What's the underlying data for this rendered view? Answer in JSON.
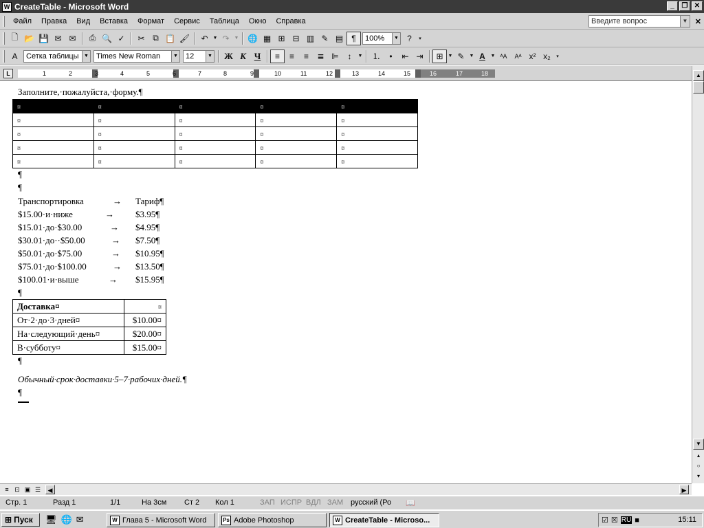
{
  "window": {
    "title": "CreateTable - Microsoft Word"
  },
  "menu": {
    "items": [
      "Файл",
      "Правка",
      "Вид",
      "Вставка",
      "Формат",
      "Сервис",
      "Таблица",
      "Окно",
      "Справка"
    ],
    "ask_placeholder": "Введите вопрос"
  },
  "toolbar_standard": {
    "zoom": "100%"
  },
  "toolbar_format": {
    "style": "Сетка таблицы",
    "font": "Times New Roman",
    "size": "12"
  },
  "ruler": {
    "numbers": [
      "1",
      "2",
      "3",
      "4",
      "5",
      "6",
      "7",
      "8",
      "9",
      "10",
      "11",
      "12",
      "13",
      "14",
      "15",
      "16",
      "17",
      "18"
    ]
  },
  "document": {
    "intro": "Заполните,·пожалуйста,·форму.¶",
    "form_table": {
      "rows": 5,
      "cols": 5,
      "cell_mark": "¤"
    },
    "empty_para": "¶",
    "tariff": {
      "header": [
        "Транспортировка",
        "Тариф¶"
      ],
      "rows": [
        [
          "$15.00·и·ниже",
          "$3.95¶"
        ],
        [
          "$15.01·до·$30.00",
          "$4.95¶"
        ],
        [
          "$30.01·до··$50.00",
          "$7.50¶"
        ],
        [
          "$50.01·до·$75.00",
          "$10.95¶"
        ],
        [
          "$75.01·до·$100.00",
          "$13.50¶"
        ],
        [
          "$100.01·и·выше",
          "$15.95¶"
        ]
      ],
      "arrow": "→"
    },
    "delivery_table": {
      "header": "Доставка¤",
      "rows": [
        [
          "От·2·до·3·дней¤",
          "$10.00¤"
        ],
        [
          "На·следующий·день¤",
          "$20.00¤"
        ],
        [
          "В·субботу¤",
          "$15.00¤"
        ]
      ]
    },
    "note": "Обычный·срок·доставки·5–7·рабочих·дней.¶"
  },
  "status": {
    "page": "Стр. 1",
    "section": "Разд 1",
    "pages": "1/1",
    "position": "На 3см",
    "line": "Ст 2",
    "column": "Кол 1",
    "rec": "ЗАП",
    "trk": "ИСПР",
    "ext": "ВДЛ",
    "ovr": "ЗАМ",
    "language": "русский (Ро"
  },
  "taskbar": {
    "start": "Пуск",
    "tasks": [
      "Глава 5 - Microsoft Word",
      "Adobe Photoshop",
      "CreateTable - Microso..."
    ],
    "lang": "RU",
    "clock": "15:11"
  }
}
